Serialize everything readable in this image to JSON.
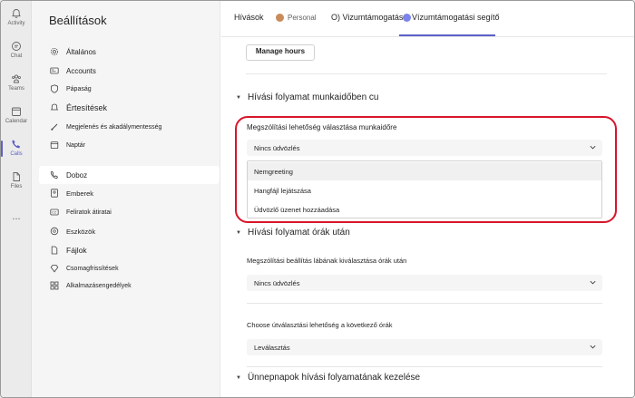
{
  "rail": [
    {
      "label": "Activity",
      "icon": "bell-icon"
    },
    {
      "label": "Chat",
      "icon": "chat-icon"
    },
    {
      "label": "Teams",
      "icon": "teams-icon"
    },
    {
      "label": "Calendar",
      "icon": "calendar-icon"
    },
    {
      "label": "Calls",
      "icon": "phone-icon",
      "active": true
    },
    {
      "label": "Files",
      "icon": "file-icon"
    },
    {
      "label": "...",
      "icon": "more-icon"
    }
  ],
  "settings": {
    "title": "Beállítások",
    "items": [
      {
        "label": "Általános",
        "icon": "gear-icon"
      },
      {
        "label": "Accounts",
        "icon": "id-card-icon"
      },
      {
        "label": "Pápaság",
        "icon": "shield-icon"
      },
      {
        "label": "Értesítések",
        "icon": "bell-icon"
      },
      {
        "label": "Megjelenés és akadálymentesség",
        "icon": "brush-icon"
      },
      {
        "label": "Naptár",
        "icon": "calendar-icon"
      },
      {
        "label": "Doboz",
        "icon": "phone-icon",
        "selected": true
      },
      {
        "label": "Emberek",
        "icon": "people-icon"
      },
      {
        "label": "Feliratok átiratai",
        "icon": "cc-icon"
      },
      {
        "label": "Eszközök",
        "icon": "speaker-icon"
      },
      {
        "label": "Fájlok",
        "icon": "file-icon"
      },
      {
        "label": "Csomagfrissítések",
        "icon": "diamond-icon"
      },
      {
        "label": "Alkalmazásengedélyek",
        "icon": "apps-icon"
      }
    ]
  },
  "tabs": {
    "hivasok": "Hívások",
    "personal": "Personal",
    "vizum1": "O) Vizumtámogatás",
    "vizum2": "Vízumtámogatási segítő"
  },
  "main": {
    "manage_button": "Manage hours",
    "section1": {
      "title": "Hívási folyamat munkaidőben cu",
      "field_label": "Megszólítási lehetőség választása munkaidőre",
      "select_value": "Nincs üdvözlés",
      "options": [
        "Nemgreeting",
        "Hangfájl lejátszása",
        "Üdvözlő üzenet hozzáadása"
      ]
    },
    "section2": {
      "title": "Hívási folyamat órák után",
      "field1_label": "Megszólítási beállítás lábának kiválasztása órák után",
      "field1_value": "Nincs üdvözlés",
      "field2_label": "Choose útválasztási lehetőség a következő órák",
      "field2_value": "Leválasztás"
    },
    "section3": {
      "title": "Ünnepnapok hívási folyamatának kezelése"
    }
  },
  "colors": {
    "accent": "#5b5fc7",
    "highlight": "#d7162b"
  }
}
